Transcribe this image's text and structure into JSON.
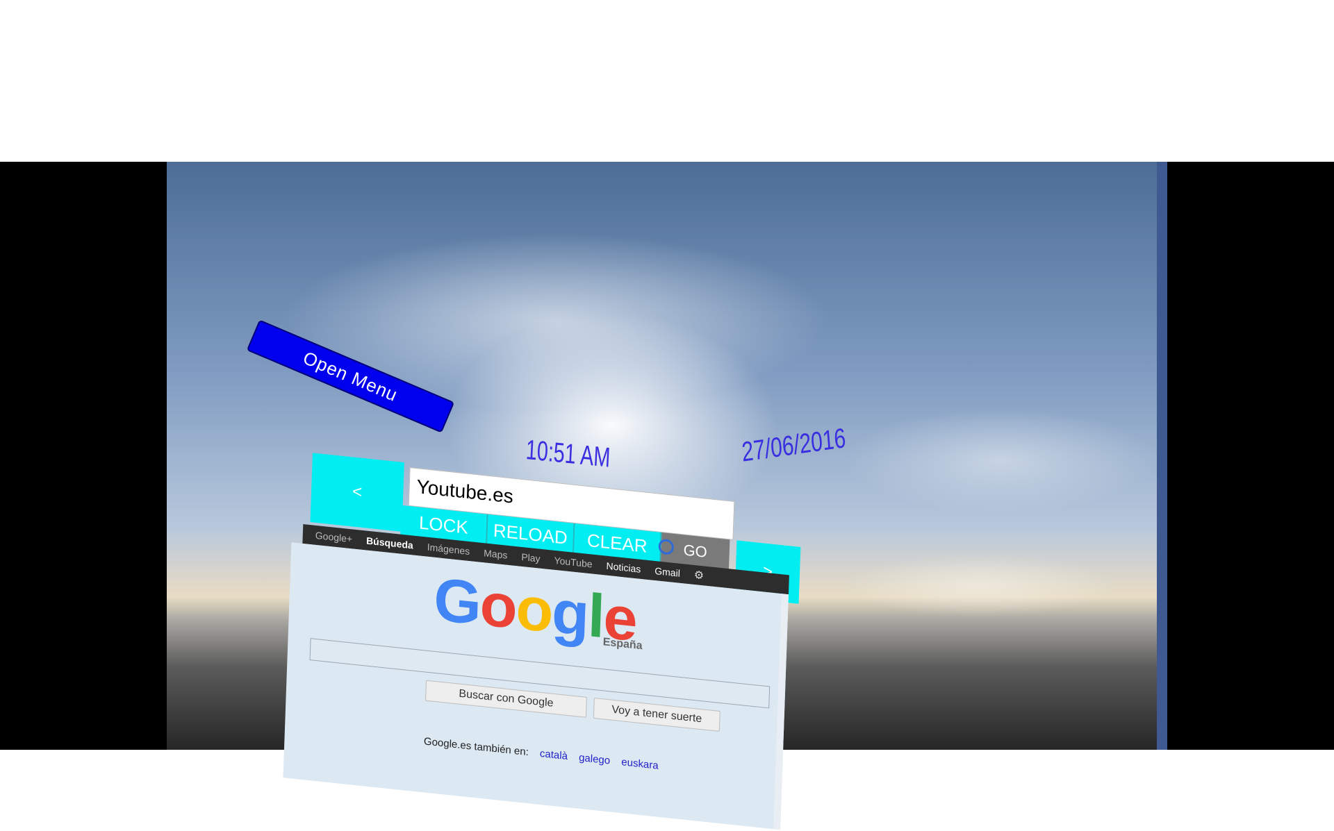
{
  "open_menu": {
    "label": "Open Menu"
  },
  "clock": {
    "time": "10:51 AM",
    "date": "27/06/2016"
  },
  "browser": {
    "back_label": "<",
    "forward_label": ">",
    "url_value": "Youtube.es",
    "buttons": {
      "lock": "LOCK",
      "reload": "RELOAD",
      "clear": "CLEAR",
      "go": "GO"
    }
  },
  "google_bar": {
    "items": [
      "Google+",
      "Búsqueda",
      "Imágenes",
      "Maps",
      "Play",
      "YouTube",
      "Noticias",
      "Gmail"
    ],
    "active": "Búsqueda"
  },
  "google_page": {
    "logo_letters": [
      "G",
      "o",
      "o",
      "g",
      "l",
      "e"
    ],
    "region": "España",
    "search_value": "",
    "search_button": "Buscar con Google",
    "lucky_button": "Voy a tener suerte",
    "also_in": "Google.es también en:",
    "languages": [
      "català",
      "galego",
      "euskara"
    ]
  },
  "colors": {
    "accent_cyan": "#00eef2",
    "menu_blue": "#0000ee",
    "clock_text": "#3a2ee0"
  }
}
